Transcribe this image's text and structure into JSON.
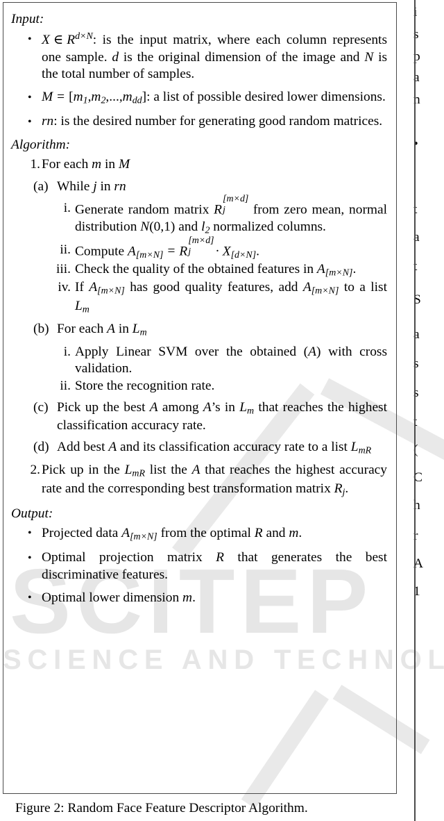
{
  "figure": {
    "caption": "Figure 2: Random Face Feature Descriptor Algorithm.",
    "border_color": "#4a4a4a"
  },
  "watermark": {
    "primary_text": "SCITEP",
    "secondary_text": "SCIENCE AND TECHNOL",
    "color": "#e6e6e6"
  },
  "sections": {
    "input_heading": "Input:",
    "algorithm_heading": "Algorithm:",
    "output_heading": "Output:"
  },
  "input_items": {
    "item1": {
      "bullet": "•",
      "math_X": "X",
      "math_in": "∈",
      "math_R": "R",
      "math_R_sup": "d×N",
      "text_a": ": is the input matrix, where each column represents one sample. ",
      "math_d": "d",
      "text_b": " is the original dimension of the image and ",
      "math_N": "N",
      "text_c": " is the total number of samples."
    },
    "item2": {
      "bullet": "•",
      "math_M": "M",
      "math_eq": "=",
      "math_list_open": "[",
      "math_m1": "m",
      "math_m1_sub": "1",
      "math_sep1": ",",
      "math_m2": "m",
      "math_m2_sub": "2",
      "math_sep2": ",...,",
      "math_mdd": "m",
      "math_mdd_sub": "dd",
      "math_list_close": "]",
      "text_a": ": a list of possible desired lower dimensions."
    },
    "item3": {
      "bullet": "•",
      "math_rn": "rn",
      "text_a": ": is the desired number for generating good random matrices."
    }
  },
  "algorithm_steps": {
    "step1": {
      "marker": "1.",
      "text_a": "For each ",
      "math_m": "m",
      "text_b": " in ",
      "math_M": "M"
    },
    "step1a": {
      "marker": "(a)",
      "text_a": "While ",
      "math_j": "j",
      "text_b": " in ",
      "math_rn": "rn"
    },
    "step1a_i": {
      "marker": "i.",
      "text_a": "Generate random matrix ",
      "math_R": "R",
      "math_R_sup": "[m×d]",
      "math_R_sub": "j",
      "text_b": " from zero mean, normal distribution ",
      "math_N": "N",
      "math_N_args": "(0,1)",
      "text_c": " and ",
      "math_l": "l",
      "math_l_sub": "2",
      "text_d": " normalized columns."
    },
    "step1a_ii": {
      "marker": "ii.",
      "text_a": "Compute ",
      "math_A": "A",
      "math_A_sub": "[m×N]",
      "math_eq": "=",
      "math_R": "R",
      "math_R_sup": "[m×d]",
      "math_R_sub": "j",
      "math_dot": "·",
      "math_X": "X",
      "math_X_sub": "[d×N]",
      "text_b": "."
    },
    "step1a_iii": {
      "marker": "iii.",
      "text_a": "Check the quality of the obtained features in ",
      "math_A": "A",
      "math_A_sub": "[m×N]",
      "text_b": "."
    },
    "step1a_iv": {
      "marker": "iv.",
      "text_a": "If ",
      "math_A1": "A",
      "math_A1_sub": "[m×N]",
      "text_b": " has good quality features, add ",
      "math_A2": "A",
      "math_A2_sub": "[m×N]",
      "text_c": " to a list ",
      "math_L": "L",
      "math_L_sub": "m"
    },
    "step1b": {
      "marker": "(b)",
      "text_a": "For each ",
      "math_A": "A",
      "text_b": " in ",
      "math_L": "L",
      "math_L_sub": "m"
    },
    "step1b_i": {
      "marker": "i.",
      "text_a": "Apply Linear SVM over the obtained (",
      "math_A": "A",
      "text_b": ") with cross validation."
    },
    "step1b_ii": {
      "marker": "ii.",
      "text_a": "Store the recognition rate."
    },
    "step1c": {
      "marker": "(c)",
      "text_a": "Pick up the best ",
      "math_A1": "A",
      "text_b": " among ",
      "math_A2": "A",
      "text_c": "’s in ",
      "math_L": "L",
      "math_L_sub": "m",
      "text_d": " that reaches the highest classification accuracy rate."
    },
    "step1d": {
      "marker": "(d)",
      "text_a": "Add best ",
      "math_A": "A",
      "text_b": " and its classification accuracy rate to a list ",
      "math_L": "L",
      "math_L_sub": "mR"
    },
    "step2": {
      "marker": "2.",
      "text_a": "Pick up in the ",
      "math_L": "L",
      "math_L_sub": "mR",
      "text_b": " list the ",
      "math_A": "A",
      "text_c": " that reaches the highest accuracy rate and the corresponding best transformation matrix ",
      "math_R": "R",
      "math_R_sub": "j",
      "text_d": "."
    }
  },
  "output_items": {
    "item1": {
      "bullet": "•",
      "text_a": "Projected data ",
      "math_A": "A",
      "math_A_sub": "[m×N]",
      "text_b": " from the optimal ",
      "math_R": "R",
      "text_c": " and ",
      "math_m": "m",
      "text_d": "."
    },
    "item2": {
      "bullet": "•",
      "text_a": "Optimal projection matrix ",
      "math_R": "R",
      "text_b": " that generates the best discriminative features."
    },
    "item3": {
      "bullet": "•",
      "text_a": "Optimal lower dimension ",
      "math_m": "m",
      "text_b": "."
    }
  },
  "right_column_fragments": {
    "l1": "i",
    "l2": "s",
    "l3": "p",
    "l4": "a",
    "l5": "n",
    "l6": "•",
    "l7": "t",
    "l8": "a",
    "l9": "t",
    "l10": "S",
    "l11": "a",
    "l12": "s",
    "l13": "s",
    "l14": "t",
    "l15": "(",
    "l16": "C",
    "l17": "h",
    "l18": "r",
    "l19": "A",
    "l20": "1"
  }
}
